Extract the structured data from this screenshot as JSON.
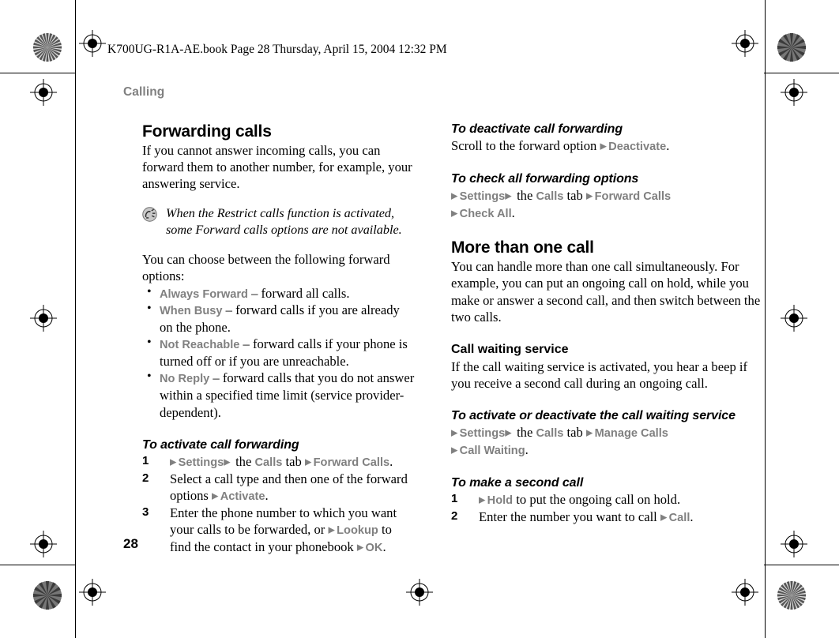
{
  "print_header": "K700UG-R1A-AE.book  Page 28  Thursday, April 15, 2004  12:32 PM",
  "running_head": "Calling",
  "page_number": "28",
  "colors": {
    "ui_term_grey": "#808080",
    "body_black": "#000000",
    "page_background": "#ffffff"
  },
  "icons": {
    "note": "tip-note-icon",
    "bullet": "•",
    "arrow": "▶"
  },
  "left_column": {
    "section_title": "Forwarding calls",
    "intro": "If you cannot answer incoming calls, you can forward them to another number, for example, your answering service.",
    "note": "When the Restrict calls function is activated, some Forward calls options are not available.",
    "options_intro": "You can choose between the following forward options:",
    "options": [
      {
        "term": "Always Forward",
        "desc": "– forward all calls."
      },
      {
        "term": "When Busy",
        "desc": "– forward calls if you are already on the phone."
      },
      {
        "term": "Not Reachable",
        "desc": "– forward calls if your phone is turned off or if you are unreachable."
      },
      {
        "term": "No Reply",
        "desc": "– forward calls that you do not answer within a specified time limit (service provider-dependent)."
      }
    ],
    "task_activate": {
      "title": "To activate call forwarding",
      "steps": [
        {
          "n": "1",
          "parts": [
            {
              "t": "arrow"
            },
            {
              "t": "ui",
              "v": "Settings"
            },
            {
              "t": "arrow"
            },
            {
              "t": "txt",
              "v": " the "
            },
            {
              "t": "ui",
              "v": "Calls"
            },
            {
              "t": "txt",
              "v": " tab "
            },
            {
              "t": "arrow"
            },
            {
              "t": "ui",
              "v": "Forward Calls"
            },
            {
              "t": "txt",
              "v": "."
            }
          ]
        },
        {
          "n": "2",
          "parts": [
            {
              "t": "txt",
              "v": "Select a call type and then one of the forward options "
            },
            {
              "t": "arrow"
            },
            {
              "t": "ui",
              "v": "Activate"
            },
            {
              "t": "txt",
              "v": "."
            }
          ]
        },
        {
          "n": "3",
          "parts": [
            {
              "t": "txt",
              "v": "Enter the phone number to which you want your calls to be forwarded, or "
            },
            {
              "t": "arrow"
            },
            {
              "t": "ui",
              "v": "Lookup"
            },
            {
              "t": "txt",
              "v": " to find the contact in your phonebook "
            },
            {
              "t": "arrow"
            },
            {
              "t": "ui",
              "v": "OK"
            },
            {
              "t": "txt",
              "v": "."
            }
          ]
        }
      ]
    }
  },
  "right_column": {
    "task_deactivate": {
      "title": "To deactivate call forwarding",
      "parts": [
        {
          "t": "txt",
          "v": "Scroll to the forward option "
        },
        {
          "t": "arrow"
        },
        {
          "t": "ui",
          "v": "Deactivate"
        },
        {
          "t": "txt",
          "v": "."
        }
      ]
    },
    "task_check_all": {
      "title": "To check all forwarding options",
      "parts": [
        {
          "t": "arrow"
        },
        {
          "t": "ui",
          "v": "Settings"
        },
        {
          "t": "arrow"
        },
        {
          "t": "txt",
          "v": " the "
        },
        {
          "t": "ui",
          "v": "Calls"
        },
        {
          "t": "txt",
          "v": " tab "
        },
        {
          "t": "arrow"
        },
        {
          "t": "ui",
          "v": "Forward Calls"
        },
        {
          "t": "br"
        },
        {
          "t": "arrow"
        },
        {
          "t": "ui",
          "v": "Check All"
        },
        {
          "t": "txt",
          "v": "."
        }
      ]
    },
    "section_title": "More than one call",
    "section_intro": "You can handle more than one call simultaneously. For example, you can put an ongoing call on hold, while you make or answer a second call, and then switch between the two calls.",
    "subsection_title": "Call waiting service",
    "subsection_intro": "If the call waiting service is activated, you hear a beep if you receive a second call during an ongoing call.",
    "task_waiting": {
      "title": "To activate or deactivate the call waiting service",
      "parts": [
        {
          "t": "arrow"
        },
        {
          "t": "ui",
          "v": "Settings"
        },
        {
          "t": "arrow"
        },
        {
          "t": "txt",
          "v": " the "
        },
        {
          "t": "ui",
          "v": "Calls"
        },
        {
          "t": "txt",
          "v": " tab "
        },
        {
          "t": "arrow"
        },
        {
          "t": "ui",
          "v": "Manage Calls"
        },
        {
          "t": "br"
        },
        {
          "t": "arrow"
        },
        {
          "t": "ui",
          "v": "Call Waiting"
        },
        {
          "t": "txt",
          "v": "."
        }
      ]
    },
    "task_second_call": {
      "title": "To make a second call",
      "steps": [
        {
          "n": "1",
          "parts": [
            {
              "t": "arrow"
            },
            {
              "t": "ui",
              "v": "Hold"
            },
            {
              "t": "txt",
              "v": " to put the ongoing call on hold."
            }
          ]
        },
        {
          "n": "2",
          "parts": [
            {
              "t": "txt",
              "v": "Enter the number you want to call "
            },
            {
              "t": "arrow"
            },
            {
              "t": "ui",
              "v": "Call"
            },
            {
              "t": "txt",
              "v": "."
            }
          ]
        }
      ]
    }
  }
}
